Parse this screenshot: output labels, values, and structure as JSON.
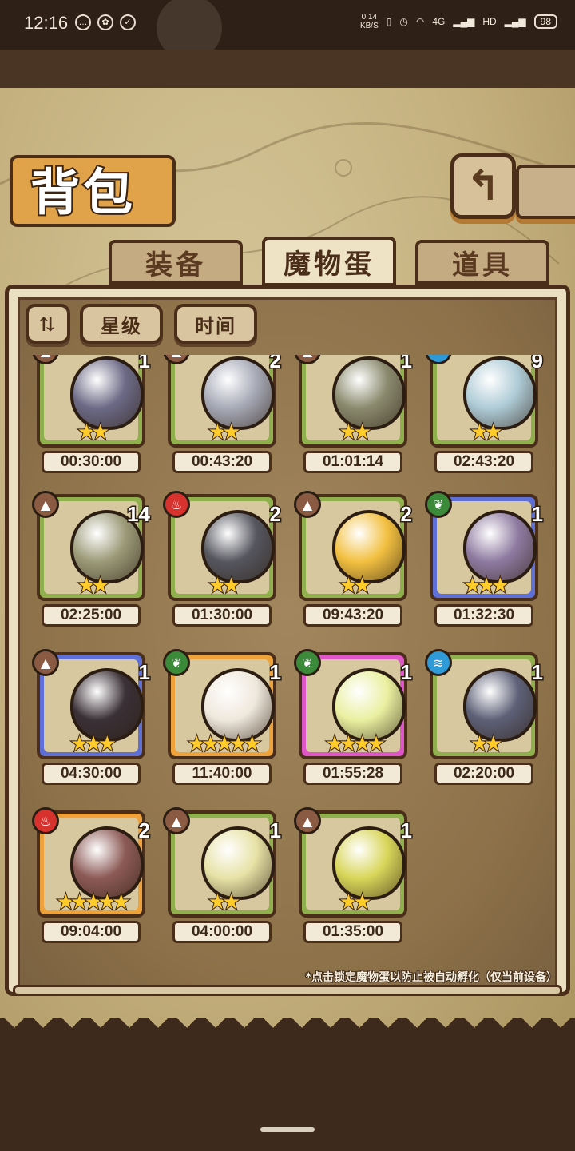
{
  "status_bar": {
    "time": "12:16",
    "net_speed_value": "0.14",
    "net_speed_unit": "KB/S",
    "signal_4g": "4G",
    "hd": "HD",
    "battery": "98"
  },
  "title": "背包",
  "tabs": [
    {
      "label": "装备",
      "active": false
    },
    {
      "label": "魔物蛋",
      "active": true
    },
    {
      "label": "道具",
      "active": false
    }
  ],
  "filters": {
    "star": "星级",
    "time": "时间"
  },
  "eggs": [
    {
      "count": "1",
      "element": "earth",
      "stars": 2,
      "timer": "00:30:00",
      "rarity": "green",
      "color": "#6c6a86"
    },
    {
      "count": "2",
      "element": "earth",
      "stars": 2,
      "timer": "00:43:20",
      "rarity": "green",
      "color": "#a7aab7"
    },
    {
      "count": "1",
      "element": "earth",
      "stars": 2,
      "timer": "01:01:14",
      "rarity": "green",
      "color": "#8a8a6e"
    },
    {
      "count": "9",
      "element": "water",
      "stars": 2,
      "timer": "02:43:20",
      "rarity": "green",
      "color": "#aecbd6"
    },
    {
      "count": "14",
      "element": "earth",
      "stars": 2,
      "timer": "02:25:00",
      "rarity": "green",
      "color": "#9b9a78"
    },
    {
      "count": "2",
      "element": "fire",
      "stars": 2,
      "timer": "01:30:00",
      "rarity": "green",
      "color": "#55565e"
    },
    {
      "count": "2",
      "element": "earth",
      "stars": 2,
      "timer": "09:43:20",
      "rarity": "green",
      "color": "#f2c040"
    },
    {
      "count": "1",
      "element": "wood",
      "stars": 3,
      "timer": "01:32:30",
      "rarity": "purple",
      "color": "#8e7aa0"
    },
    {
      "count": "1",
      "element": "earth",
      "stars": 3,
      "timer": "04:30:00",
      "rarity": "purple",
      "color": "#3a3036"
    },
    {
      "count": "1",
      "element": "wood",
      "stars": 5,
      "timer": "11:40:00",
      "rarity": "orange",
      "color": "#efe8dc"
    },
    {
      "count": "1",
      "element": "wood",
      "stars": 4,
      "timer": "01:55:28",
      "rarity": "pink",
      "color": "#e9f0a0"
    },
    {
      "count": "1",
      "element": "water",
      "stars": 2,
      "timer": "02:20:00",
      "rarity": "green",
      "color": "#5d6077"
    },
    {
      "count": "2",
      "element": "fire",
      "stars": 5,
      "timer": "09:04:00",
      "rarity": "orange",
      "color": "#8c5a56"
    },
    {
      "count": "1",
      "element": "earth",
      "stars": 2,
      "timer": "04:00:00",
      "rarity": "green",
      "color": "#e7e2a6"
    },
    {
      "count": "1",
      "element": "earth",
      "stars": 2,
      "timer": "01:35:00",
      "rarity": "green",
      "color": "#d9d65a"
    }
  ],
  "element_colors": {
    "earth": "#8a5a42",
    "fire": "#d8322e",
    "wood": "#3a8a3a",
    "water": "#2e9ad8"
  },
  "element_icons": {
    "earth": "▲",
    "fire": "♨",
    "wood": "❦",
    "water": "≋"
  },
  "hint": "*点击锁定魔物蛋以防止被自动孵化（仅当前设备）"
}
